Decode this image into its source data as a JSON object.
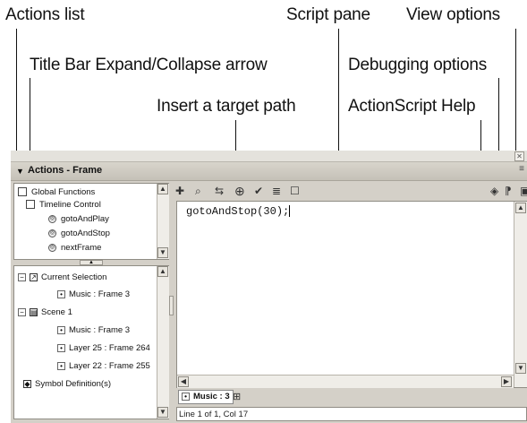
{
  "callouts": {
    "actions_list": "Actions list",
    "script_pane": "Script pane",
    "view_options": "View options",
    "title_bar_arrow": "Title Bar Expand/Collapse arrow",
    "debugging_options": "Debugging options",
    "insert_target_path": "Insert a target path",
    "actionscript_help": "ActionScript Help"
  },
  "panel": {
    "title": "Actions - Frame",
    "actions_list": [
      "Global Functions",
      "Timeline Control",
      "gotoAndPlay",
      "gotoAndStop",
      "nextFrame"
    ],
    "script_navigator": [
      "Current Selection",
      "Music : Frame 3",
      "Scene 1",
      "Music : Frame 3",
      "Layer 25 : Frame 264",
      "Layer 22 : Frame 255",
      "Symbol Definition(s)"
    ],
    "script_text": "gotoAndStop(30);",
    "script_tab": "Music : 3",
    "status": "Line 1 of 1, Col 17"
  },
  "icons": {
    "toolbar": [
      "add-icon",
      "find-icon",
      "replace-icon",
      "target-path-icon",
      "check-syntax-icon",
      "auto-format-icon",
      "code-hint-icon"
    ],
    "right_toolbar": [
      "help-icon",
      "debug-options-icon",
      "view-options-icon"
    ]
  }
}
